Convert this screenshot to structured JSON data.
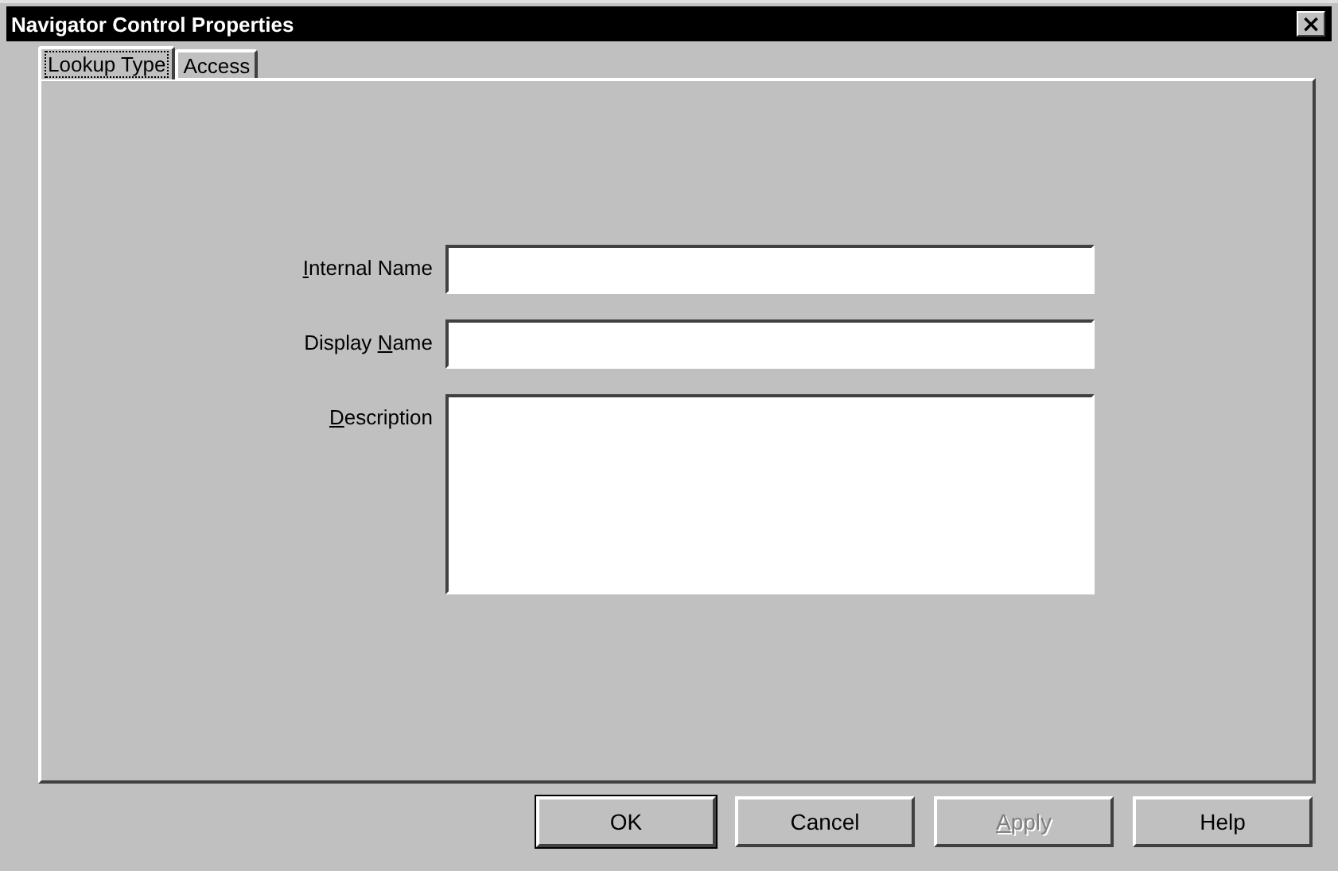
{
  "window": {
    "title": "Navigator Control Properties",
    "close": "×"
  },
  "tabs": [
    {
      "label": "Lookup Type",
      "selected": true
    },
    {
      "label": "Access",
      "selected": false
    }
  ],
  "fields": [
    {
      "label": {
        "key": "I",
        "after": "nternal Name"
      },
      "kind": "line"
    },
    {
      "label": {
        "before": "Display ",
        "key": "N",
        "after": "ame"
      },
      "kind": "line"
    },
    {
      "label": {
        "key": "D",
        "after": "escription"
      },
      "kind": "area"
    }
  ],
  "buttons": [
    {
      "label": {
        "before": "OK"
      },
      "default": true,
      "disabled": false
    },
    {
      "label": {
        "before": "Cancel"
      },
      "default": false,
      "disabled": false
    },
    {
      "label": {
        "key": "A",
        "after": "pply"
      },
      "default": false,
      "disabled": true
    },
    {
      "label": {
        "before": "Help"
      },
      "default": false,
      "disabled": false
    }
  ]
}
